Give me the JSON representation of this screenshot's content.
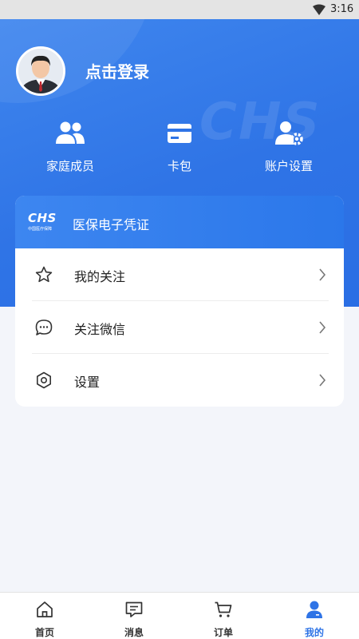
{
  "status_bar": {
    "time": "3:16"
  },
  "profile": {
    "login_label": "点击登录"
  },
  "quick_actions": [
    {
      "label": "家庭成员",
      "icon": "family-members-icon"
    },
    {
      "label": "卡包",
      "icon": "card-icon"
    },
    {
      "label": "账户设置",
      "icon": "account-settings-icon"
    }
  ],
  "card": {
    "logo_text": "CHS",
    "logo_sub": "中国医疗保障",
    "title": "医保电子凭证",
    "menu": [
      {
        "label": "我的关注",
        "icon": "star-icon"
      },
      {
        "label": "关注微信",
        "icon": "chat-bubble-icon"
      },
      {
        "label": "设置",
        "icon": "settings-gear-icon"
      }
    ]
  },
  "tabbar": {
    "tabs": [
      {
        "label": "首页",
        "icon": "home-icon"
      },
      {
        "label": "消息",
        "icon": "message-icon"
      },
      {
        "label": "订单",
        "icon": "cart-icon"
      },
      {
        "label": "我的",
        "icon": "user-icon"
      }
    ],
    "active": "我的"
  },
  "colors": {
    "primary": "#2f74e6",
    "background": "#f3f5fa"
  }
}
